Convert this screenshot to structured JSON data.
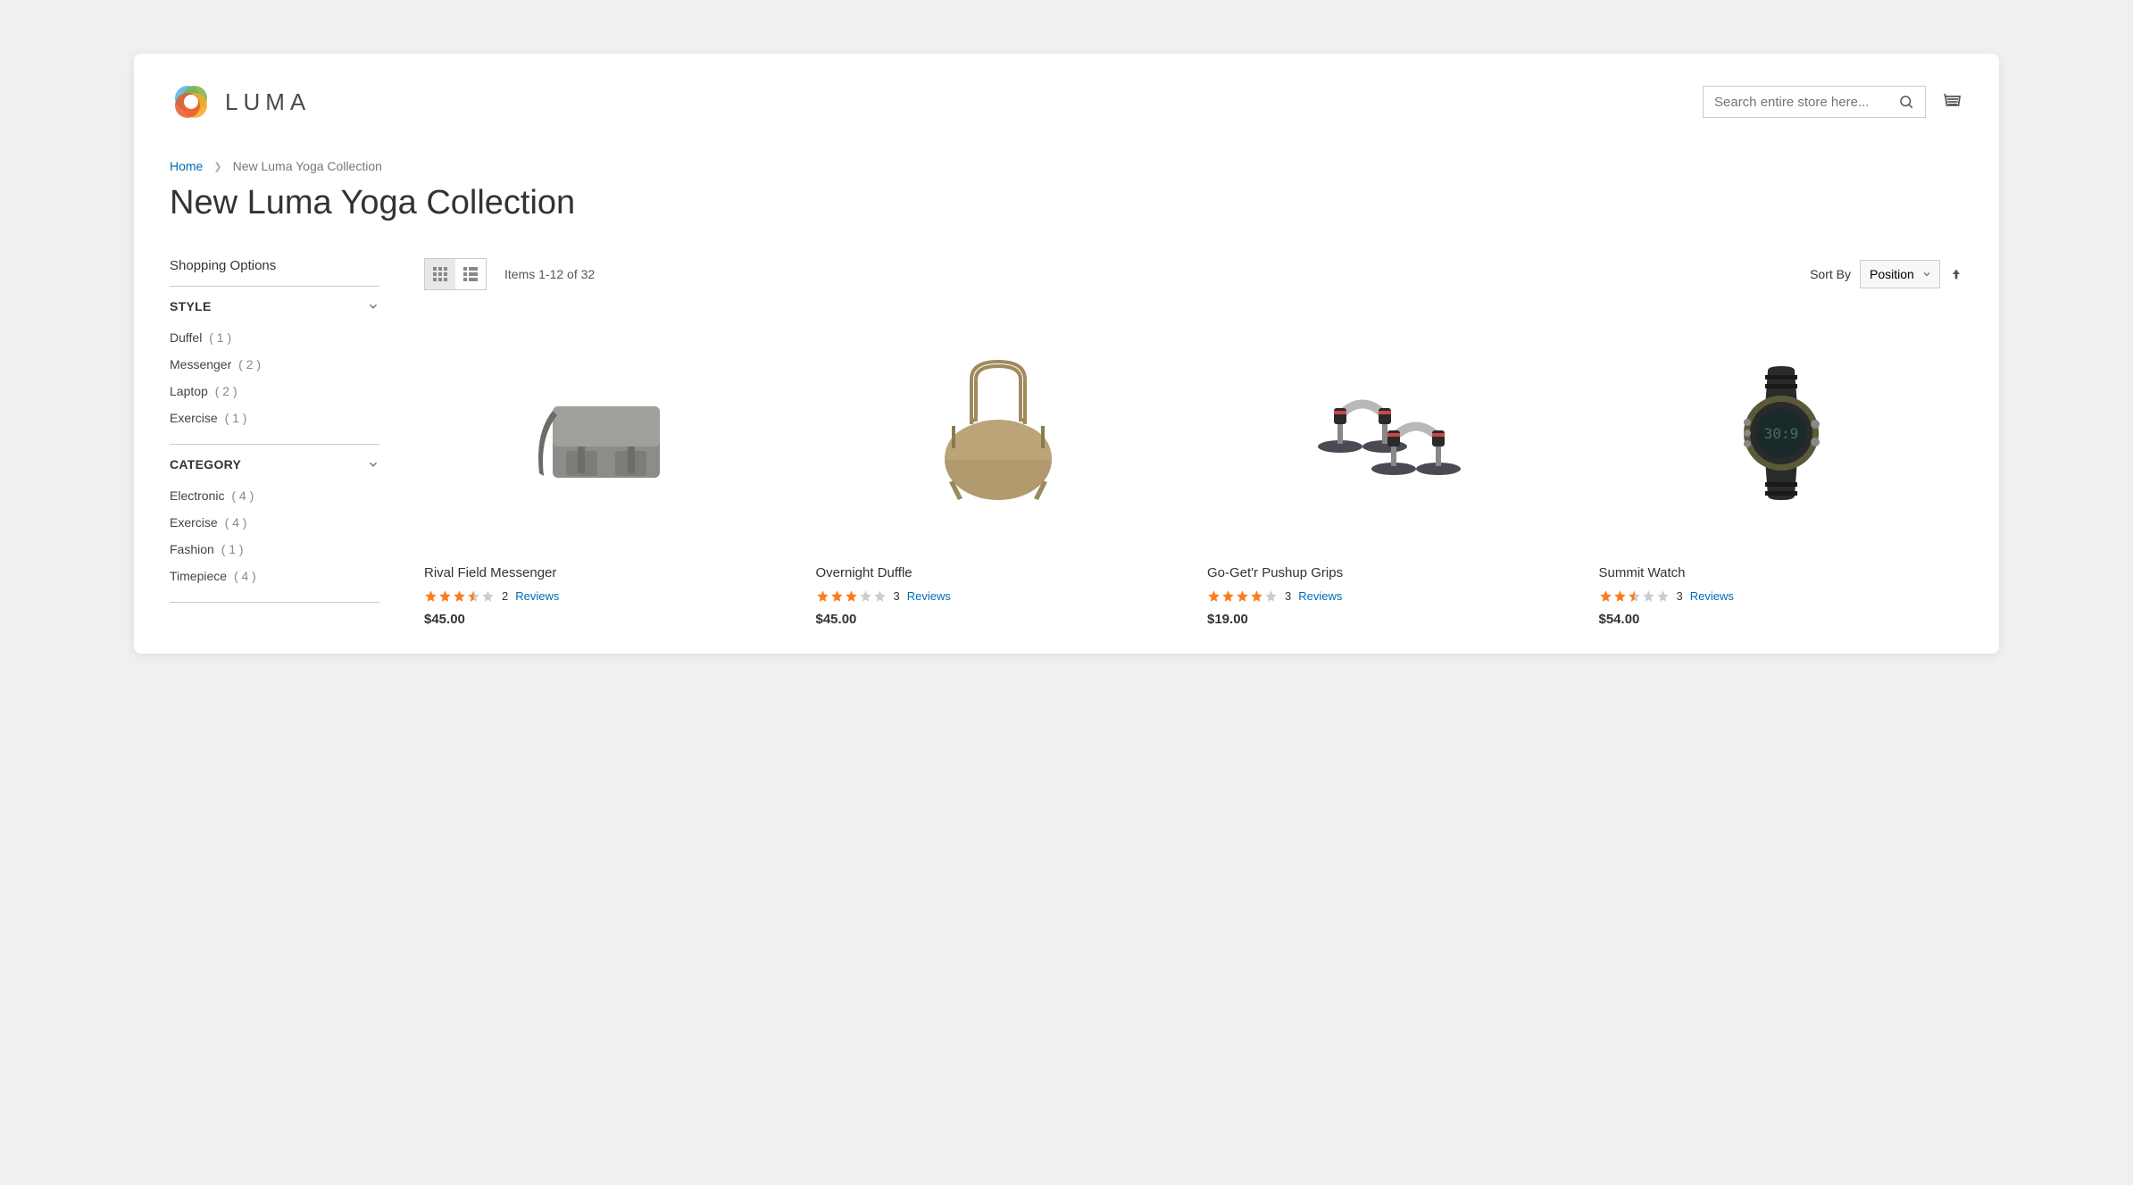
{
  "header": {
    "logo_text": "LUMA",
    "search_placeholder": "Search entire store here..."
  },
  "breadcrumb": {
    "home": "Home",
    "current": "New Luma Yoga Collection"
  },
  "page_title": "New Luma Yoga Collection",
  "sidebar": {
    "title": "Shopping Options",
    "facets": [
      {
        "title": "STYLE",
        "items": [
          {
            "label": "Duffel",
            "count": "( 1 )"
          },
          {
            "label": "Messenger",
            "count": "( 2 )"
          },
          {
            "label": "Laptop",
            "count": "( 2 )"
          },
          {
            "label": "Exercise",
            "count": "( 1 )"
          }
        ]
      },
      {
        "title": "CATEGORY",
        "items": [
          {
            "label": "Electronic",
            "count": "( 4 )"
          },
          {
            "label": "Exercise",
            "count": "( 4 )"
          },
          {
            "label": "Fashion",
            "count": "( 1 )"
          },
          {
            "label": "Timepiece",
            "count": "( 4 )"
          }
        ]
      }
    ]
  },
  "toolbar": {
    "count_text": "Items 1-12 of 32",
    "sort_label": "Sort By",
    "sort_value": "Position"
  },
  "products": [
    {
      "name": "Rival Field Messenger",
      "rating": 3.5,
      "reviews": "2",
      "reviews_label": "Reviews",
      "price": "$45.00"
    },
    {
      "name": "Overnight Duffle",
      "rating": 3,
      "reviews": "3",
      "reviews_label": "Reviews",
      "price": "$45.00"
    },
    {
      "name": "Go-Get'r Pushup Grips",
      "rating": 4,
      "reviews": "3",
      "reviews_label": "Reviews",
      "price": "$19.00"
    },
    {
      "name": "Summit Watch",
      "rating": 2.5,
      "reviews": "3",
      "reviews_label": "Reviews",
      "price": "$54.00"
    }
  ]
}
